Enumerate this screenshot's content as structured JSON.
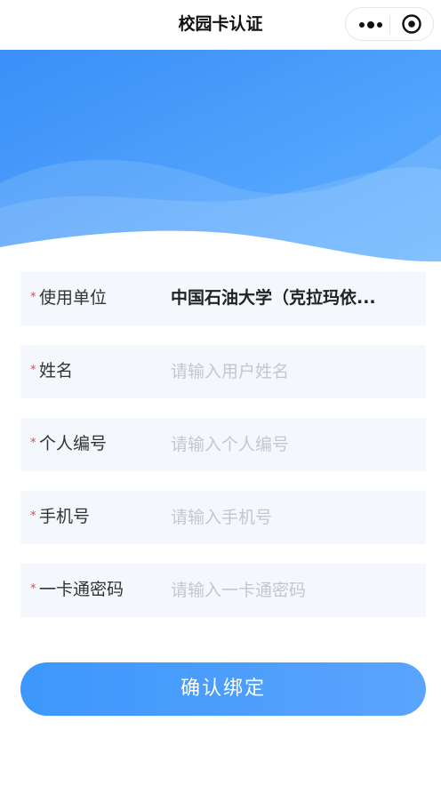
{
  "navbar": {
    "title": "校园卡认证"
  },
  "form": {
    "fields": [
      {
        "label": "使用单位",
        "required_mark": "*",
        "value": "中国石油大学（克拉玛依..."
      },
      {
        "label": "姓名",
        "required_mark": "*",
        "placeholder": "请输入用户姓名",
        "value": ""
      },
      {
        "label": "个人编号",
        "required_mark": "*",
        "placeholder": "请输入个人编号",
        "value": ""
      },
      {
        "label": "手机号",
        "required_mark": "*",
        "placeholder": "请输入手机号",
        "value": ""
      },
      {
        "label": "一卡通密码",
        "required_mark": "*",
        "placeholder": "请输入一卡通密码",
        "value": ""
      }
    ]
  },
  "actions": {
    "bind_label": "确认绑定"
  },
  "colors": {
    "accent": "#3d97fb",
    "required": "#e8453c",
    "field_background": "#f4f8fc",
    "placeholder": "#c4c7cc"
  },
  "icons": {
    "more": "more-dots-icon",
    "close": "close-circle-icon"
  }
}
